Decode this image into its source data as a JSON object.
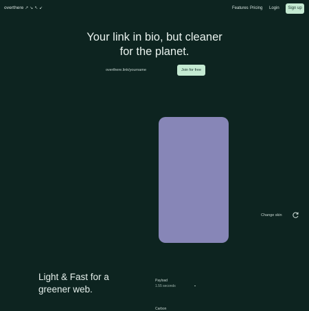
{
  "nav": {
    "logo_text": "overthere",
    "logo_mark": "↗ ↘ ↖ ↙",
    "features": "Features",
    "pricing": "Pricing",
    "login": "Login",
    "signup": "Sign up"
  },
  "hero": {
    "title_line1": "Your link in bio, but cleaner",
    "title_line2": "for the planet.",
    "input_value": "overthere.link/yourname",
    "join_label": "Join for free"
  },
  "preview": {
    "phone_color": "#8786b7",
    "change_skin": "Change skin",
    "refresh_icon": "refresh-icon"
  },
  "section": {
    "title_line1": "Light & Fast for a",
    "title_line2": "greener web.",
    "stat_label": "Payload",
    "stat_value": "1.55 seconds",
    "stat_label2": "Carbon"
  },
  "colors": {
    "background": "#0d2420",
    "accent": "#c4ead2"
  }
}
